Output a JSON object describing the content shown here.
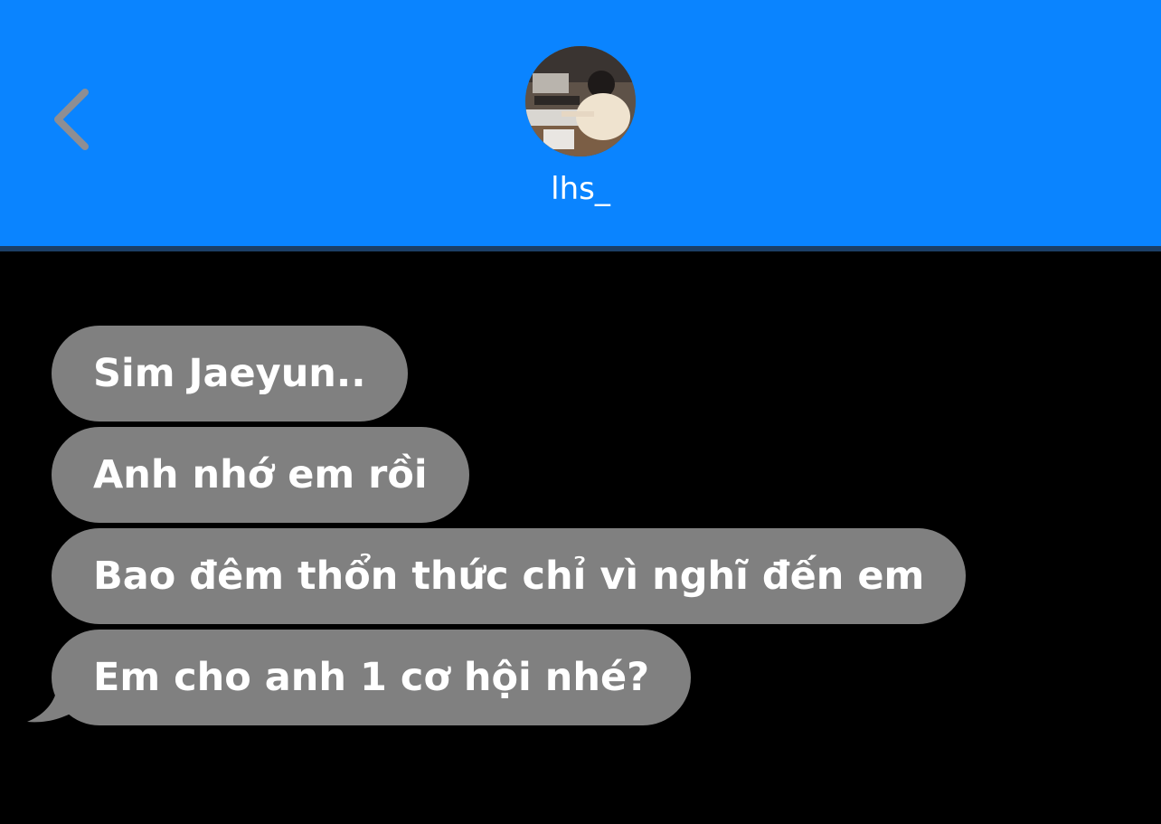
{
  "header": {
    "back_icon": "chevron-left-icon",
    "contact_name": "lhs_",
    "avatar": "contact-photo",
    "background_color": "#0a84ff"
  },
  "messages": [
    {
      "text": "Sim Jaeyun.."
    },
    {
      "text": "Anh nhớ em rồi"
    },
    {
      "text": "Bao đêm thổn thức chỉ vì nghĩ đến em"
    },
    {
      "text": "Em cho anh 1 cơ hội nhé?"
    }
  ],
  "colors": {
    "bubble": "#808080",
    "background": "#000000",
    "text": "#ffffff"
  }
}
